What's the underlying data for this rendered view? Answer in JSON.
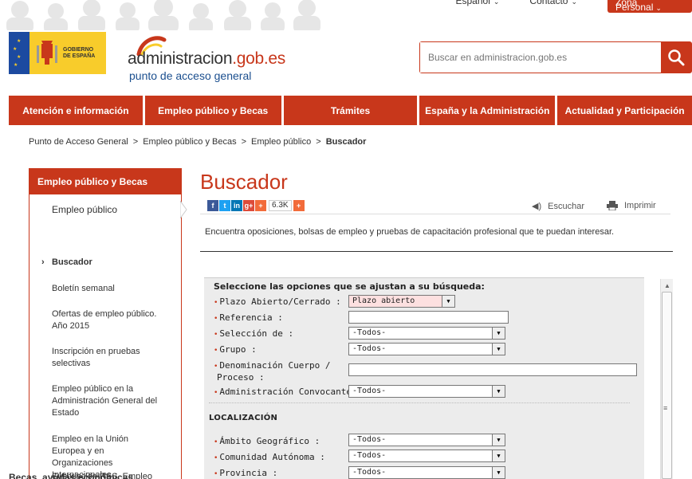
{
  "topbar": {
    "language": "Español",
    "contact": "Contacto",
    "personal_zone": "Zona Personal"
  },
  "gov_logo": {
    "line1": "GOBIERNO",
    "line2": "DE ESPAÑA"
  },
  "site_logo": {
    "name_prefix": "administracion",
    "name_suffix": ".gob.es",
    "tagline": "punto de acceso general"
  },
  "search": {
    "placeholder": "Buscar en administracion.gob.es"
  },
  "nav": {
    "items": [
      "Atención e información",
      "Empleo público y Becas",
      "Trámites",
      "España y la Administración",
      "Actualidad y Participación"
    ]
  },
  "breadcrumb": {
    "items": [
      "Punto de Acceso General",
      "Empleo público y Becas",
      "Empleo público",
      "Buscador"
    ],
    "separator": ">"
  },
  "sidebar": {
    "header": "Empleo público y Becas",
    "first": "Empleo público",
    "items": [
      "Buscador",
      "Boletín semanal",
      "Ofertas de empleo público. Año 2015",
      "Inscripción en pruebas selectivas",
      "Empleo público en la Administración General del Estado",
      "Empleo en la Unión Europea y en Organizaciones Internacionales",
      "Suscripción RSS. Empleo público"
    ],
    "next_section": "Becas, ayudas económicas..."
  },
  "main": {
    "title": "Buscador",
    "share_count": "6.3K",
    "listen": "Escuchar",
    "print": "Imprimir",
    "intro": "Encuentra oposiciones, bolsas de empleo y pruebas de capacitación profesional que te puedan interesar."
  },
  "form": {
    "title": "Seleccione las opciones que se ajustan a su búsqueda:",
    "fields": {
      "plazo": {
        "label": "Plazo Abierto/Cerrado :",
        "value": "Plazo abierto"
      },
      "referencia": {
        "label": "Referencia :",
        "value": ""
      },
      "seleccion": {
        "label": "Selección de :",
        "value": "-Todos-"
      },
      "grupo": {
        "label": "Grupo :",
        "value": "-Todos-"
      },
      "denominacion": {
        "label1": "Denominación Cuerpo /",
        "label2": "Proceso :",
        "value": ""
      },
      "administracion": {
        "label": "Administración Convocante :",
        "value": "-Todos-"
      }
    },
    "localizacion": {
      "heading": "LOCALIZACIÓN",
      "ambito": {
        "label": "Ámbito Geográfico :",
        "value": "-Todos-"
      },
      "comunidad": {
        "label": "Comunidad Autónoma :",
        "value": "-Todos-"
      },
      "provincia": {
        "label": "Provincia :",
        "value": "-Todos-"
      }
    }
  },
  "colors": {
    "brand_red": "#c8371b",
    "link_blue": "#1b4f8f",
    "logo_yellow": "#f8cc2b"
  }
}
